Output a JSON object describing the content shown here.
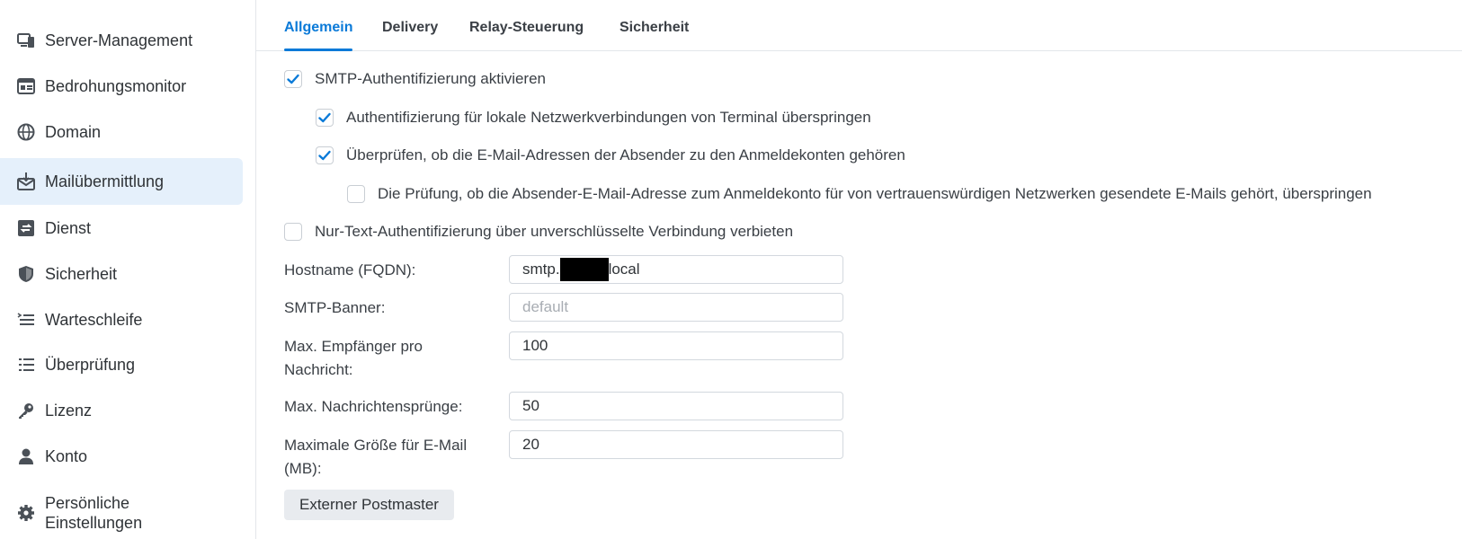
{
  "sidebar": {
    "items": [
      {
        "label": "Server-Management",
        "icon": "server-management-icon"
      },
      {
        "label": "Bedrohungsmonitor",
        "icon": "threat-monitor-icon"
      },
      {
        "label": "Domain",
        "icon": "globe-icon"
      },
      {
        "label": "Mailübermittlung",
        "icon": "mail-delivery-icon",
        "active": true
      },
      {
        "label": "Dienst",
        "icon": "service-icon"
      },
      {
        "label": "Sicherheit",
        "icon": "shield-icon"
      },
      {
        "label": "Warteschleife",
        "icon": "queue-icon"
      },
      {
        "label": "Überprüfung",
        "icon": "audit-list-icon"
      },
      {
        "label": "Lizenz",
        "icon": "key-icon"
      },
      {
        "label": "Konto",
        "icon": "user-icon"
      },
      {
        "label": "Persönliche Einstellungen",
        "label_line1": "Persönliche",
        "label_line2": "Einstellungen",
        "icon": "gear-icon"
      }
    ]
  },
  "tabs": [
    {
      "label": "Allgemein",
      "active": true
    },
    {
      "label": "Delivery"
    },
    {
      "label": "Relay-Steuerung"
    },
    {
      "label": "Sicherheit"
    }
  ],
  "options": {
    "smtp_auth": {
      "label": "SMTP-Authentifizierung aktivieren",
      "checked": true
    },
    "skip_local": {
      "label": "Authentifizierung für lokale Netzwerkverbindungen von Terminal überspringen",
      "checked": true
    },
    "verify_sender": {
      "label": "Überprüfen, ob die E-Mail-Adressen der Absender zu den Anmeldekonten gehören",
      "checked": true
    },
    "skip_trusted": {
      "label": "Die Prüfung, ob die Absender-E-Mail-Adresse zum Anmeldekonto für von vertrauenswürdigen Netzwerken gesendete E-Mails gehört, überspringen",
      "checked": false
    },
    "no_plaintext": {
      "label": "Nur-Text-Authentifizierung über unverschlüsselte Verbindung verbieten",
      "checked": false
    }
  },
  "form": {
    "hostname": {
      "label": "Hostname (FQDN):",
      "value_prefix": "smtp.",
      "value_suffix": "local"
    },
    "banner": {
      "label": "SMTP-Banner:",
      "value": "",
      "placeholder": "default"
    },
    "max_recipients": {
      "label_line1": "Max. Empfänger pro",
      "label_line2": "Nachricht:",
      "value": "100"
    },
    "max_hops": {
      "label": "Max. Nachrichtensprünge:",
      "value": "50"
    },
    "max_size": {
      "label_line1": "Maximale Größe für E-Mail",
      "label_line2": "(MB):",
      "value": "20"
    }
  },
  "buttons": {
    "external_postmaster": "Externer Postmaster"
  },
  "colors": {
    "accent": "#0a7ad8",
    "active_bg": "#e5f0fb"
  }
}
